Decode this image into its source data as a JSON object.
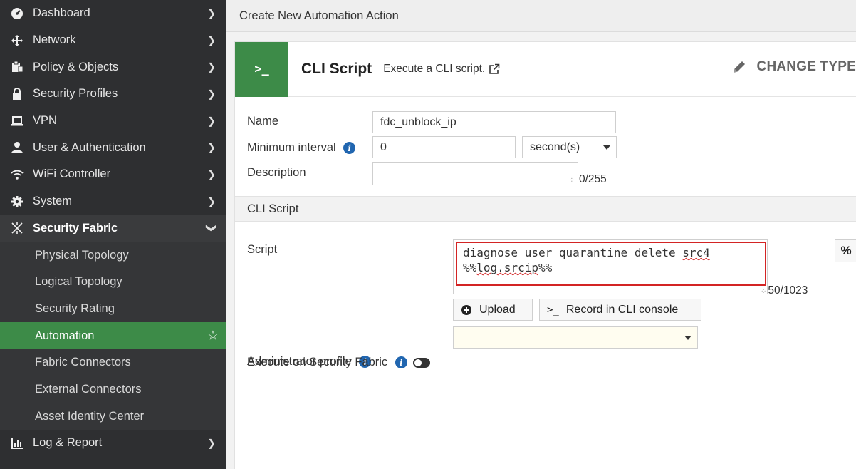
{
  "sidebar": {
    "items": [
      {
        "label": "Dashboard",
        "icon": "dashboard-icon"
      },
      {
        "label": "Network",
        "icon": "network-icon"
      },
      {
        "label": "Policy & Objects",
        "icon": "policy-icon"
      },
      {
        "label": "Security Profiles",
        "icon": "lock-icon"
      },
      {
        "label": "VPN",
        "icon": "laptop-icon"
      },
      {
        "label": "User & Authentication",
        "icon": "user-icon"
      },
      {
        "label": "WiFi Controller",
        "icon": "wifi-icon"
      },
      {
        "label": "System",
        "icon": "gear-icon"
      },
      {
        "label": "Security Fabric",
        "icon": "fabric-icon"
      }
    ],
    "sub_items": [
      "Physical Topology",
      "Logical Topology",
      "Security Rating",
      "Automation",
      "Fabric Connectors",
      "External Connectors",
      "Asset Identity Center"
    ],
    "bottom_item": {
      "label": "Log & Report",
      "icon": "chart-icon"
    }
  },
  "page": {
    "title": "Create New Automation Action"
  },
  "action_type": {
    "badge": ">_",
    "title": "CLI Script",
    "description": "Execute a CLI script.",
    "change_type": "CHANGE TYPE"
  },
  "form": {
    "name_label": "Name",
    "name_value": "fdc_unblock_ip",
    "interval_label": "Minimum interval",
    "interval_value": "0",
    "interval_unit": "second(s)",
    "description_label": "Description",
    "description_value": "",
    "description_counter": "0/255",
    "section_title": "CLI Script",
    "script_label": "Script",
    "script_line1_a": "diagnose user quarantine delete ",
    "script_line1_b": "src4",
    "script_line2_a": "%%",
    "script_line2_b": "log.srcip",
    "script_line2_c": "%%",
    "script_counter": "50/1023",
    "percent_button": "%",
    "upload_button": "Upload",
    "record_button": "Record in CLI console",
    "admin_profile_label": "Administrator profile",
    "admin_profile_value": "",
    "execute_label": "Execute on Security Fabric"
  }
}
